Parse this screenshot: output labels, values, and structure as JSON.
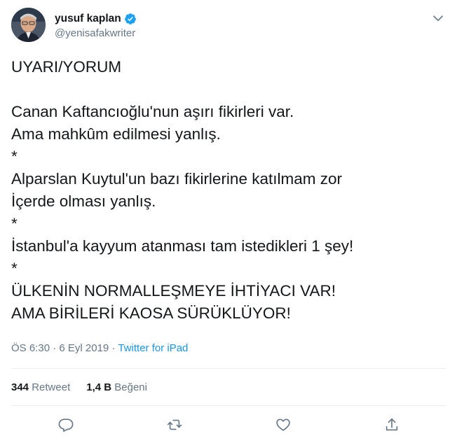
{
  "author": {
    "display_name": "yusuf kaplan",
    "handle": "@yenisafakwriter",
    "verified_icon": "verified-badge-icon",
    "avatar_icon": "avatar",
    "menu_icon": "chevron-down-icon"
  },
  "tweet": {
    "lines": [
      "UYARI/YORUM",
      "",
      "Canan Kaftancıoğlu'nun aşırı fikirleri var.",
      "Ama mahkûm edilmesi yanlış.",
      "*",
      "Alparslan Kuytul'un bazı fikirlerine katılmam zor",
      "İçerde olması yanlış.",
      "*",
      "İstanbul'a kayyum atanması tam istedikleri 1 şey!",
      "*",
      "ÜLKENİN NORMALLEŞMEYE İHTİYACI VAR!",
      "AMA BİRİLERİ KAOSA SÜRÜKLÜYOR!"
    ],
    "time": "ÖS 6:30",
    "separator": "·",
    "date": "6 Eyl 2019",
    "source": "Twitter for iPad"
  },
  "stats": {
    "retweets_count": "344",
    "retweets_label": "Retweet",
    "likes_count": "1,4 B",
    "likes_label": "Beğeni"
  },
  "actions": {
    "reply_icon": "reply-icon",
    "retweet_icon": "retweet-icon",
    "like_icon": "heart-icon",
    "share_icon": "share-icon"
  },
  "colors": {
    "text": "#14171a",
    "secondary": "#657786",
    "accent": "#1b95e0",
    "divider": "#e6ecf0"
  }
}
